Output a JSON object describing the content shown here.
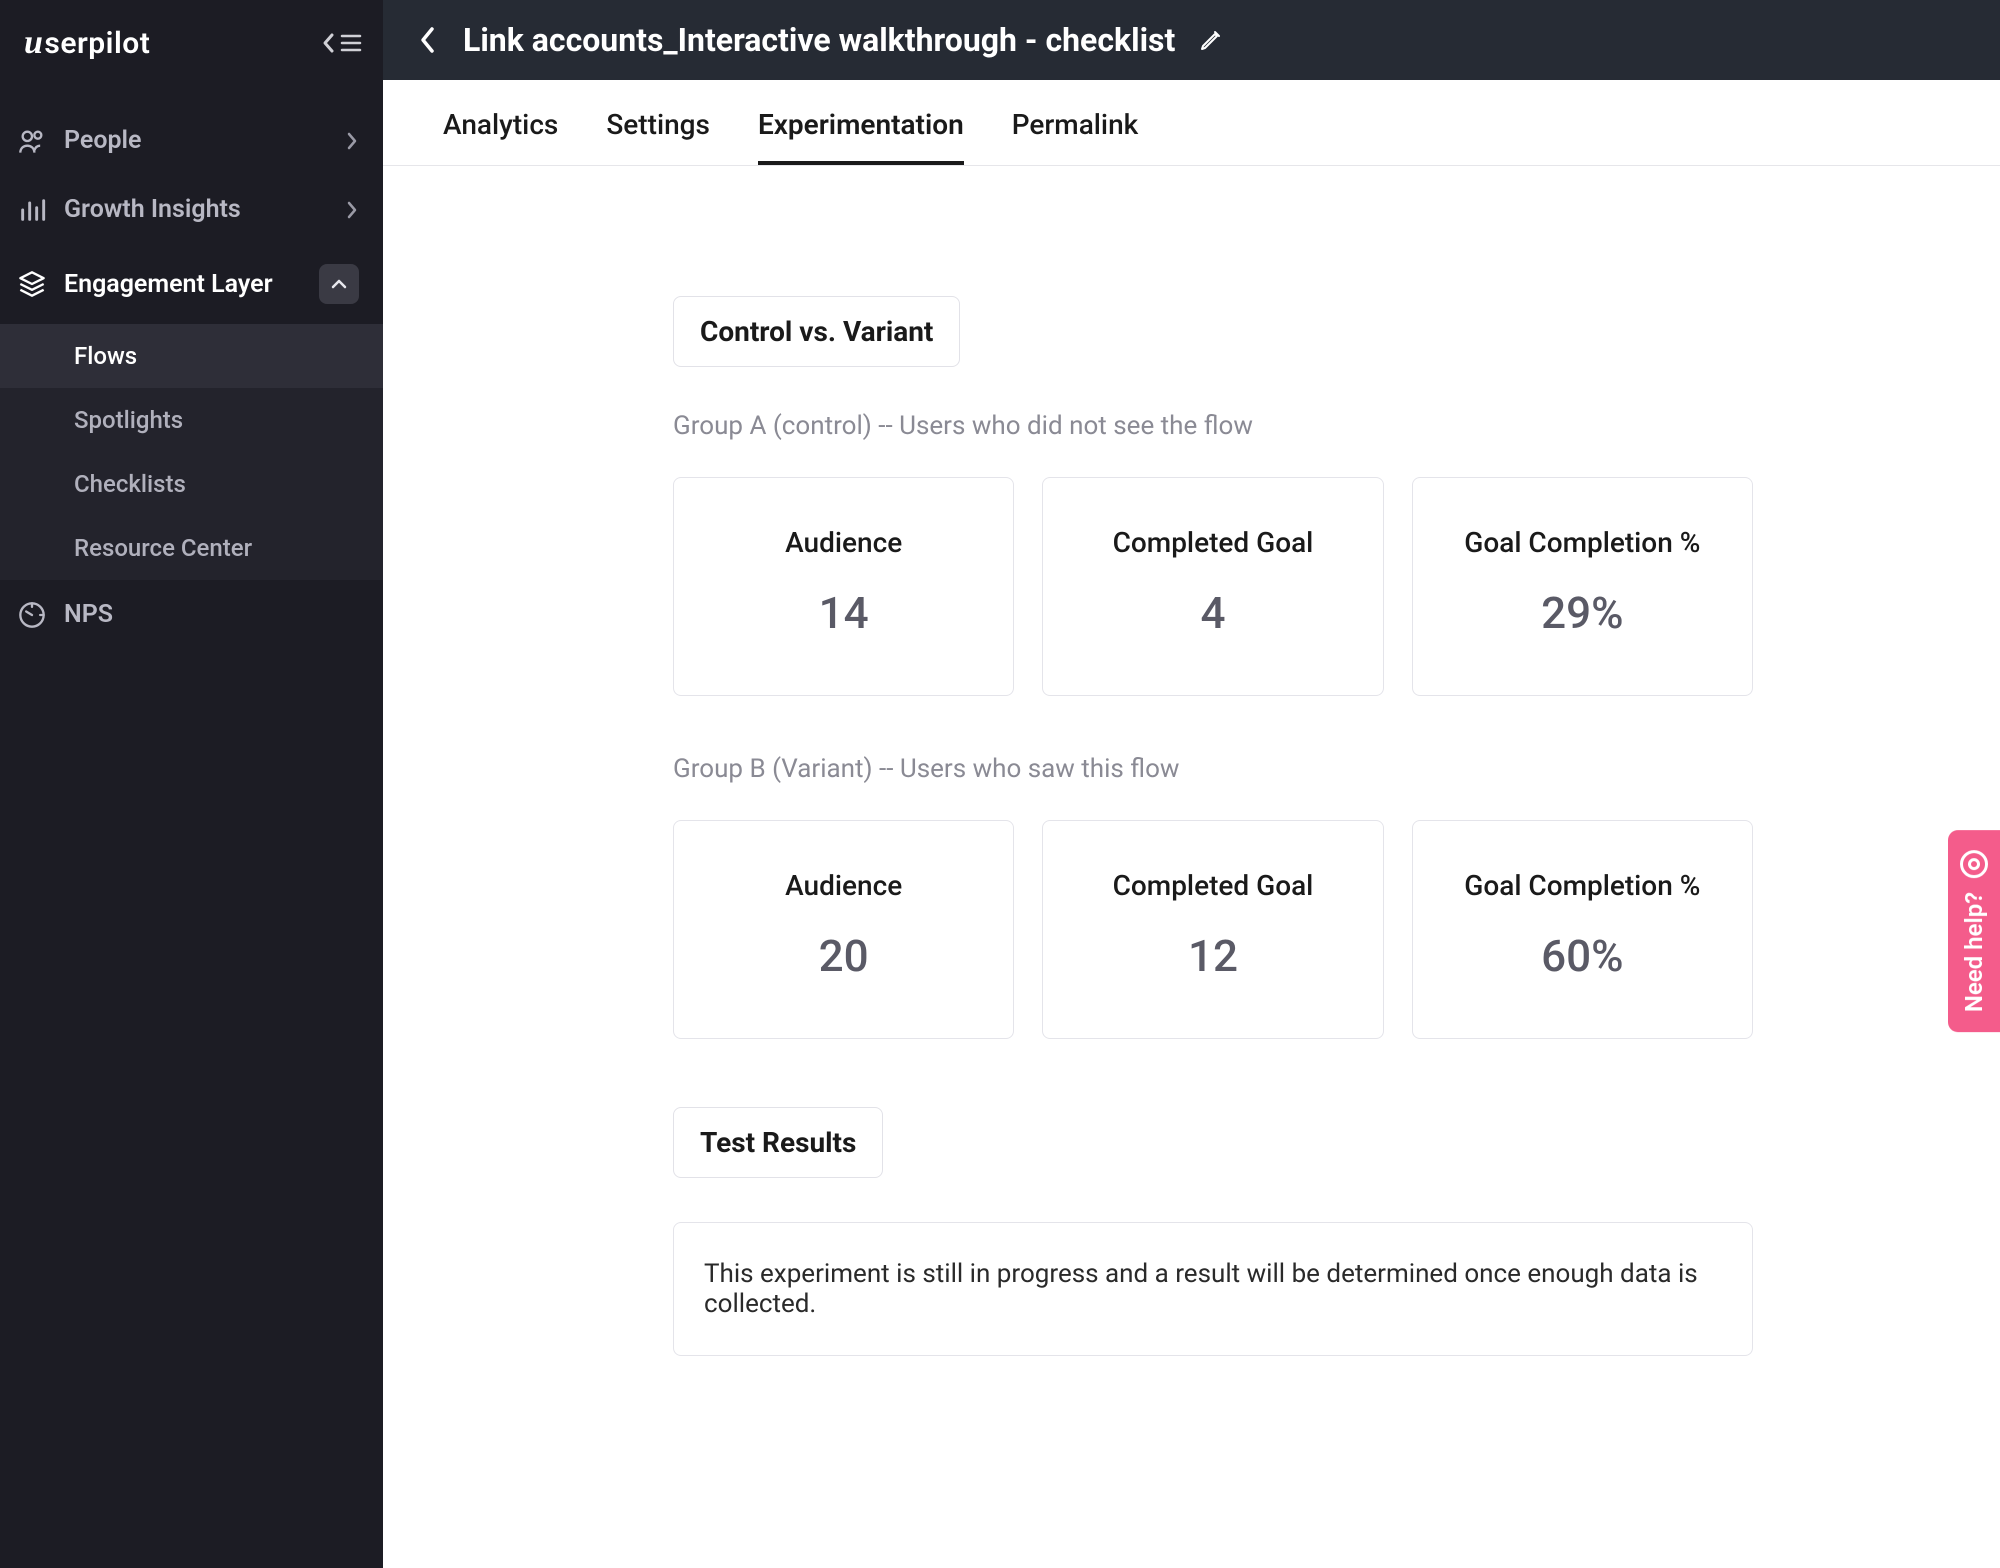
{
  "brand": "serpilot",
  "header": {
    "title": "Link accounts_Interactive walkthrough - checklist"
  },
  "sidebar": {
    "items": [
      {
        "label": "People"
      },
      {
        "label": "Growth Insights"
      },
      {
        "label": "Engagement Layer"
      },
      {
        "label": "NPS"
      }
    ],
    "engagement_sub": [
      {
        "label": "Flows"
      },
      {
        "label": "Spotlights"
      },
      {
        "label": "Checklists"
      },
      {
        "label": "Resource Center"
      }
    ]
  },
  "tabs": [
    {
      "label": "Analytics"
    },
    {
      "label": "Settings"
    },
    {
      "label": "Experimentation"
    },
    {
      "label": "Permalink"
    }
  ],
  "section_title": "Control vs. Variant",
  "groups": [
    {
      "label": "Group A (control) -- Users who did not see the flow",
      "stats": [
        {
          "title": "Audience",
          "value": "14"
        },
        {
          "title": "Completed Goal",
          "value": "4"
        },
        {
          "title": "Goal Completion %",
          "value": "29%"
        }
      ]
    },
    {
      "label": "Group B (Variant) -- Users who saw this flow",
      "stats": [
        {
          "title": "Audience",
          "value": "20"
        },
        {
          "title": "Completed Goal",
          "value": "12"
        },
        {
          "title": "Goal Completion %",
          "value": "60%"
        }
      ]
    }
  ],
  "results_title": "Test Results",
  "results_text": "This experiment is still in progress and a result will be determined once enough data is collected.",
  "help_label": "Need help?"
}
